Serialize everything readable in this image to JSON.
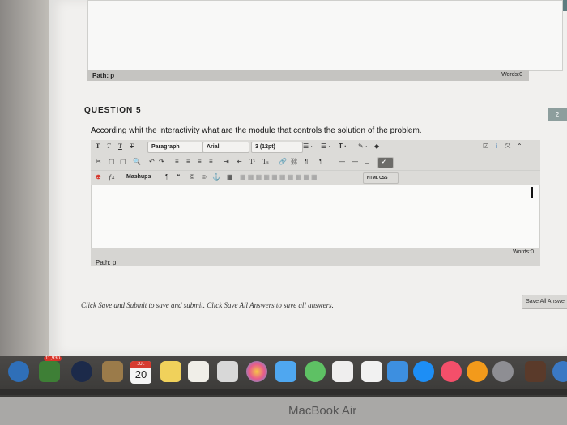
{
  "previous_editor": {
    "path_label": "Path: p",
    "words_label": "Words:0"
  },
  "question": {
    "title": "QUESTION 5",
    "points_badge": "2",
    "text": "According whit the interactivity what are the module that controls the solution of the problem."
  },
  "toolbar": {
    "row1": {
      "format_buttons": [
        "T",
        "T",
        "T",
        "T"
      ],
      "paragraph": "Paragraph",
      "font": "Arial",
      "size": "3 (12pt)"
    },
    "row3": {
      "mashups": "Mashups",
      "html_css": "HTML CSS"
    }
  },
  "editor": {
    "path_label": "Path: p",
    "words_label": "Words:0"
  },
  "instructions": "Click Save and Submit to save and submit. Click Save All Answers to save all answers.",
  "save_all_button": "Save All Answe",
  "dock": {
    "calendar_day": "20",
    "calendar_month": "JUL",
    "badge": "11,930"
  },
  "laptop_brand": "MacBook Air",
  "colors": {
    "page_bg": "#f1f0ee",
    "toolbar_bg": "#dcdbd8",
    "dock_bg": "#4a4846"
  }
}
